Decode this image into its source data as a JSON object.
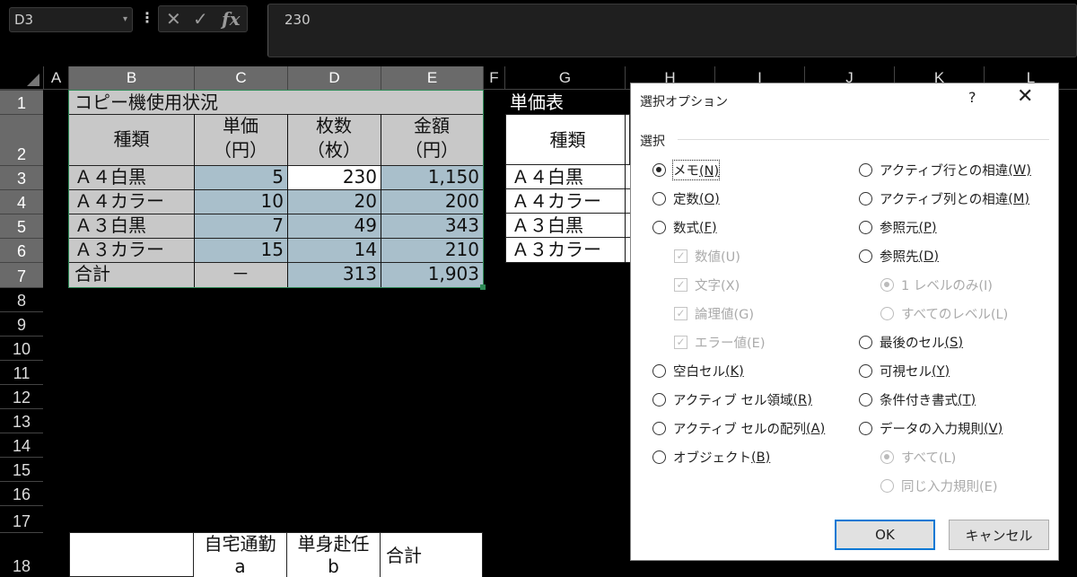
{
  "formula_bar": {
    "name_box": "D3",
    "formula_value": "230",
    "cancel_icon": "✕",
    "enter_icon": "✓",
    "fx_icon": "fx"
  },
  "column_headers": [
    "A",
    "B",
    "C",
    "D",
    "E",
    "F",
    "G",
    "H",
    "I",
    "J",
    "K",
    "L"
  ],
  "row_headers": [
    "1",
    "2",
    "3",
    "4",
    "5",
    "6",
    "7",
    "8",
    "9",
    "10",
    "11",
    "12",
    "13",
    "14",
    "15",
    "16",
    "17",
    "18"
  ],
  "sheet": {
    "table1_title": "コピー機使用状況",
    "headers": {
      "kind": "種類",
      "unit_price_1": "単価",
      "unit_price_2": "（円）",
      "sheets_1": "枚数",
      "sheets_2": "（枚）",
      "amount_1": "金額",
      "amount_2": "（円）"
    },
    "rows": [
      {
        "kind": "Ａ４白黒",
        "price": "5",
        "count": "230",
        "amount": "1,150"
      },
      {
        "kind": "Ａ４カラー",
        "price": "10",
        "count": "20",
        "amount": "200"
      },
      {
        "kind": "Ａ３白黒",
        "price": "7",
        "count": "49",
        "amount": "343"
      },
      {
        "kind": "Ａ３カラー",
        "price": "15",
        "count": "14",
        "amount": "210"
      }
    ],
    "total": {
      "kind": "合計",
      "price": "－",
      "count": "313",
      "amount": "1,903"
    },
    "table2_title": "単価表",
    "table2_header": "種類",
    "table2_rows": [
      "Ａ４白黒",
      "Ａ４カラー",
      "Ａ３白黒",
      "Ａ３カラー"
    ],
    "table3": {
      "col1_line1": "自宅通勤",
      "col1_line2": "a",
      "col2_line1": "単身赴任",
      "col2_line2": "b",
      "col3": "合計"
    }
  },
  "dialog": {
    "title": "選択オプション",
    "help": "?",
    "close": "✕",
    "section": "選択",
    "left_options": [
      {
        "label": "メモ",
        "key": "(N)",
        "state": "checked"
      },
      {
        "label": "定数",
        "key": "(O)",
        "state": "unchecked"
      },
      {
        "label": "数式",
        "key": "(F)",
        "state": "unchecked"
      },
      {
        "label": "数値(U)",
        "state": "disabled-checkbox"
      },
      {
        "label": "文字(X)",
        "state": "disabled-checkbox"
      },
      {
        "label": "論理値(G)",
        "state": "disabled-checkbox"
      },
      {
        "label": "エラー値(E)",
        "state": "disabled-checkbox"
      },
      {
        "label": "空白セル",
        "key": "(K)",
        "state": "unchecked"
      },
      {
        "label": "アクティブ セル領域",
        "key": "(R)",
        "state": "unchecked"
      },
      {
        "label": "アクティブ セルの配列",
        "key": "(A)",
        "state": "unchecked"
      },
      {
        "label": "オブジェクト",
        "key": "(B)",
        "state": "unchecked"
      }
    ],
    "right_options": [
      {
        "label": "アクティブ行との相違",
        "key": "(W)",
        "state": "unchecked"
      },
      {
        "label": "アクティブ列との相違",
        "key": "(M)",
        "state": "unchecked"
      },
      {
        "label": "参照元",
        "key": "(P)",
        "state": "unchecked"
      },
      {
        "label": "参照先",
        "key": "(D)",
        "state": "unchecked"
      },
      {
        "label": "1 レベルのみ(I)",
        "state": "disabled-checked"
      },
      {
        "label": "すべてのレベル(L)",
        "state": "disabled"
      },
      {
        "label": "最後のセル",
        "key": "(S)",
        "state": "unchecked"
      },
      {
        "label": "可視セル",
        "key": "(Y)",
        "state": "unchecked"
      },
      {
        "label": "条件付き書式",
        "key": "(T)",
        "state": "unchecked"
      },
      {
        "label": "データの入力規則",
        "key": "(V)",
        "state": "unchecked"
      },
      {
        "label": "すべて(L)",
        "state": "disabled-checked"
      },
      {
        "label": "同じ入力規則(E)",
        "state": "disabled"
      }
    ],
    "ok": "OK",
    "cancel": "キャンセル"
  }
}
